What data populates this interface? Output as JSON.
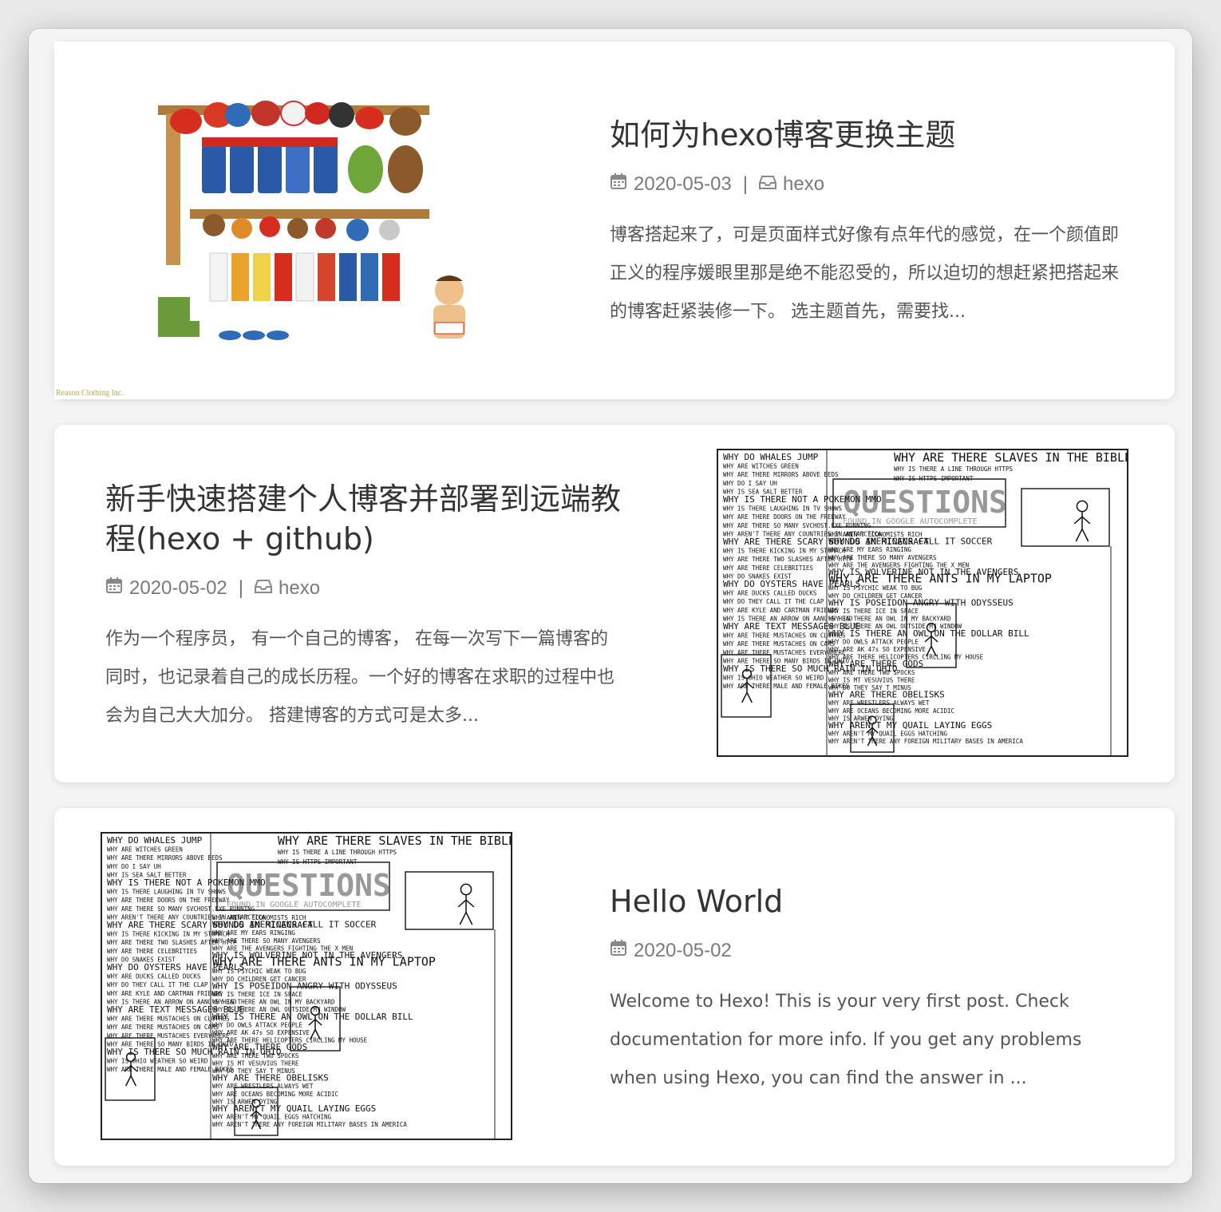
{
  "posts": [
    {
      "title": "如何为hexo博客更换主题",
      "date": "2020-05-03",
      "category": "hexo",
      "excerpt": "博客搭起来了，可是页面样式好像有点年代的感觉，在一个颜值即正义的程序媛眼里那是绝不能忍受的，所以迫切的想赶紧把搭起来的博客赶紧装修一下。 选主题首先，需要找...",
      "image": {
        "type": "illustration",
        "credit": "Reason Clothing Inc."
      }
    },
    {
      "title": "新手快速搭建个人博客并部署到远端教程(hexo + github)",
      "date": "2020-05-02",
      "category": "hexo",
      "excerpt": "作为一个程序员， 有一个自己的博客， 在每一次写下一篇博客的同时，也记录着自己的成长历程。一个好的博客在求职的过程中也会为自己大大加分。 搭建博客的方式可是太多...",
      "image": {
        "type": "comic"
      }
    },
    {
      "title": "Hello World",
      "date": "2020-05-02",
      "excerpt": "Welcome to Hexo! This is your very first post. Check documentation for more info. If you get any problems when using Hexo, you can find the answer in ...",
      "image": {
        "type": "comic"
      }
    }
  ],
  "comic": {
    "heading": "QUESTIONS",
    "subheading": "FOUND IN GOOGLE AUTOCOMPLETE",
    "lines_left": [
      "WHY DO WHALES JUMP",
      "WHY ARE WITCHES GREEN",
      "WHY ARE THERE MIRRORS ABOVE BEDS",
      "WHY DO I SAY UH",
      "WHY IS SEA SALT BETTER",
      "WHY IS THERE NOT A POKEMON MMO",
      "WHY IS THERE LAUGHING IN TV SHOWS",
      "WHY ARE THERE DOORS ON THE FREEWAY",
      "WHY ARE THERE SO MANY SVCHOST.EXE RUNNING",
      "WHY AREN'T THERE ANY COUNTRIES IN ANTARCTICA",
      "WHY ARE THERE SCARY SOUNDS IN MINECRAFT",
      "WHY IS THERE KICKING IN MY STOMACH",
      "WHY ARE THERE TWO SLASHES AFTER HTTP",
      "WHY ARE THERE CELEBRITIES",
      "WHY DO SNAKES EXIST",
      "WHY DO OYSTERS HAVE PEARLS",
      "WHY ARE DUCKS CALLED DUCKS",
      "WHY DO THEY CALL IT THE CLAP",
      "WHY ARE KYLE AND CARTMAN FRIENDS",
      "WHY IS THERE AN ARROW ON AANG'S HEAD",
      "WHY ARE TEXT MESSAGES BLUE",
      "WHY ARE THERE MUSTACHES ON CLOTHES",
      "WHY ARE THERE MUSTACHES ON CARS",
      "WHY ARE THERE MUSTACHES EVERYWHERE",
      "WHY ARE THERE SO MANY BIRDS IN OHIO",
      "WHY IS THERE SO MUCH RAIN IN OHIO",
      "WHY IS OHIO WEATHER SO WEIRD",
      "WHY ARE THERE MALE AND FEMALE BIKES"
    ],
    "lines_right": [
      "WHY ARE THERE SLAVES IN THE BIBLE",
      "WHY IS THERE A LINE THROUGH HTTPS",
      "WHY IS HTTPS IMPORTANT",
      "WHY AREN'T ECONOMISTS RICH",
      "WHY DO AMERICANS CALL IT SOCCER",
      "WHY ARE MY EARS RINGING",
      "WHY ARE THERE SO MANY AVENGERS",
      "WHY ARE THE AVENGERS FIGHTING THE X MEN",
      "WHY IS WOLVERINE NOT IN THE AVENGERS",
      "WHY ARE THERE ANTS IN MY LAPTOP",
      "WHY IS PSYCHIC WEAK TO BUG",
      "WHY DO CHILDREN GET CANCER",
      "WHY IS POSEIDON ANGRY WITH ODYSSEUS",
      "WHY IS THERE ICE IN SPACE",
      "WHY IS THERE AN OWL IN MY BACKYARD",
      "WHY IS THERE AN OWL OUTSIDE MY WINDOW",
      "WHY IS THERE AN OWL ON THE DOLLAR BILL",
      "WHY DO OWLS ATTACK PEOPLE",
      "WHY ARE AK 47s SO EXPENSIVE",
      "WHY ARE THERE HELICOPTERS CIRCLING MY HOUSE",
      "WHY ARE THERE GODS",
      "WHY ARE THERE TWO SPOCKS",
      "WHY IS MT VESUVIUS THERE",
      "WHY DO THEY SAY T MINUS",
      "WHY ARE THERE OBELISKS",
      "WHY ARE WRESTLERS ALWAYS WET",
      "WHY ARE OCEANS BECOMING MORE ACIDIC",
      "WHY IS ARWEN DYING",
      "WHY AREN'T MY QUAIL LAYING EGGS",
      "WHY AREN'T MY QUAIL EGGS HATCHING",
      "WHY AREN'T THERE ANY FOREIGN MILITARY BASES IN AMERICA"
    ]
  },
  "colors": {
    "title": "#333333",
    "meta": "#7a7a7a",
    "excerpt": "#555555",
    "card_bg": "#ffffff",
    "page_bg": "#f4f4f4"
  },
  "icons": {
    "date": "calendar-icon",
    "category": "inbox-icon"
  }
}
